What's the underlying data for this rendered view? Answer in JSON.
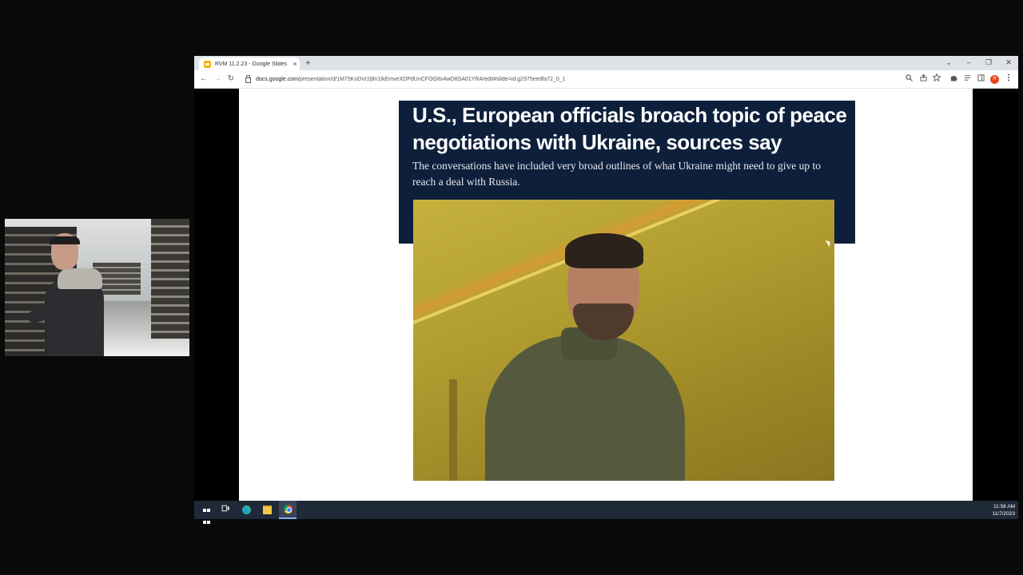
{
  "browser": {
    "tab_title": "RVM 11.2.23 - Google Slides",
    "tab_close": "×",
    "new_tab": "+",
    "url_host": "docs.google.com",
    "url_path": "/presentation/d/1M75KnDVr2j8n1IkEmveXDPdUnCFOG8s4wO8SA01YRA/edit#slide=id.g2975eedfa72_0_1",
    "window_controls": {
      "collapse": "⌄",
      "minimize": "–",
      "restore": "❐",
      "close": "✕"
    },
    "nav": {
      "back": "←",
      "forward": "→",
      "reload": "↻"
    },
    "profile_initial": "R"
  },
  "slide": {
    "headline": "U.S., European officials broach topic of peace negotiations with Ukraine, sources say",
    "subhead": "The conversations have included very broad outlines of what Ukraine might need to give up to reach a deal with Russia.",
    "colors": {
      "header_bg": "#0e1f3b",
      "headline_text": "#ffffff"
    }
  },
  "taskbar": {
    "time": "11:58 AM",
    "date": "11/7/2023"
  }
}
